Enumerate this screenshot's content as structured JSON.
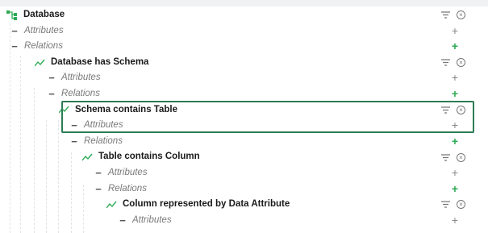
{
  "dash": "−",
  "plus": "+",
  "tree": {
    "root": {
      "label": "Database"
    },
    "attributes": "Attributes",
    "relations": "Relations",
    "level1": {
      "label": "Database has Schema"
    },
    "level2": {
      "label": "Schema contains Table"
    },
    "level3": {
      "label": "Table contains Column"
    },
    "level4": {
      "label": "Column represented by Data Attribute"
    }
  },
  "colors": {
    "accent": "#2eaa55",
    "highlight": "#2e7d55"
  },
  "icons": {
    "root": "hierarchy-icon",
    "relation": "trend-line-icon",
    "filter": "filter-icon",
    "remove": "close-circle-icon"
  }
}
